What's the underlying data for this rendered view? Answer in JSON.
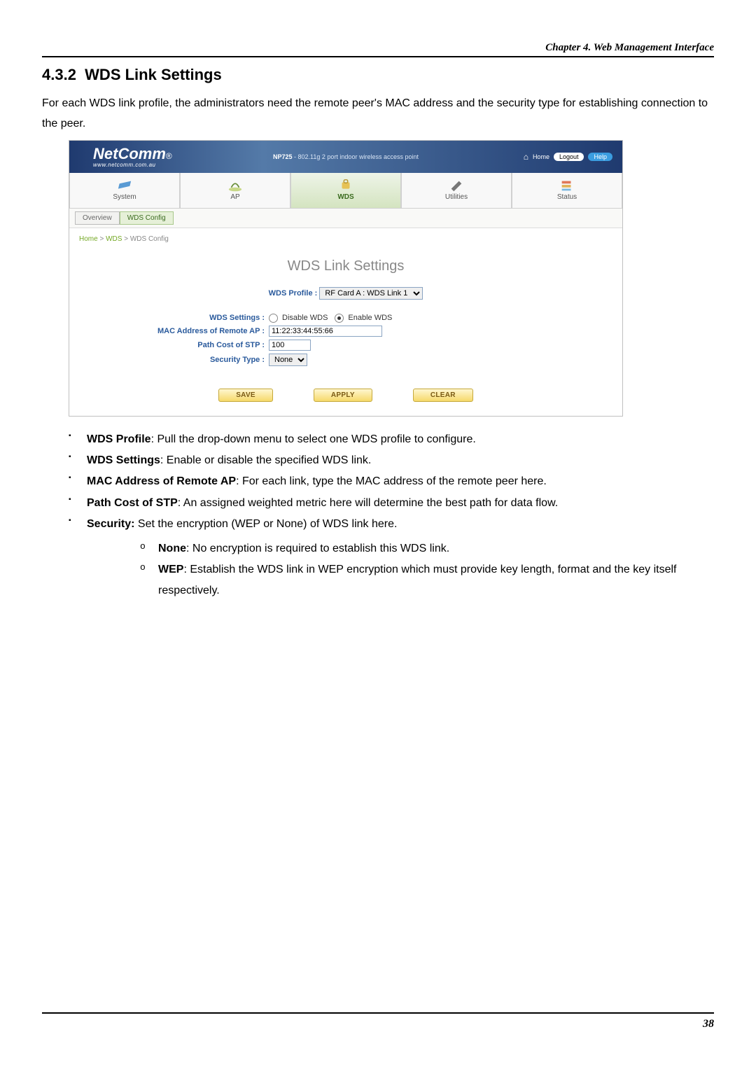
{
  "chapter_header": "Chapter 4. Web Management Interface",
  "section_number": "4.3.2",
  "section_title": "WDS Link Settings",
  "intro_text": "For each WDS link profile, the administrators need the remote peer's MAC address and the security type for establishing connection to the peer.",
  "screenshot": {
    "logo_text": "NetComm",
    "logo_sub": "www.netcomm.com.au",
    "product_name": "NP725",
    "product_desc": " - 802.11g 2 port indoor wireless access point",
    "top_home": "Home",
    "top_logout": "Logout",
    "top_help": "Help",
    "nav": [
      "System",
      "AP",
      "WDS",
      "Utilities",
      "Status"
    ],
    "subtabs": [
      "Overview",
      "WDS Config"
    ],
    "crumb_home": "Home",
    "crumb_wds": "WDS",
    "crumb_leaf": "WDS Config",
    "panel_title": "WDS Link Settings",
    "profile_label": "WDS Profile :",
    "profile_value": "RF Card A : WDS Link 1",
    "rows": {
      "wds_settings_label": "WDS Settings :",
      "disable_label": "Disable WDS",
      "enable_label": "Enable WDS",
      "mac_label": "MAC Address of Remote AP :",
      "mac_value": "11:22:33:44:55:66",
      "path_label": "Path Cost of STP :",
      "path_value": "100",
      "sec_label": "Security Type :",
      "sec_value": "None"
    },
    "buttons": {
      "save": "SAVE",
      "apply": "APPLY",
      "clear": "CLEAR"
    }
  },
  "bullets": {
    "b1_title": "WDS Profile",
    "b1_text": ": Pull the drop-down menu to select one WDS profile to configure.",
    "b2_title": "WDS Settings",
    "b2_text": ": Enable or disable the specified WDS link.",
    "b3_title": "MAC Address of Remote AP",
    "b3_text": ": For each link, type the MAC address of the remote peer here.",
    "b4_title": "Path Cost of STP",
    "b4_text": ": An assigned weighted metric here will determine the best path for data flow.",
    "b5_title": "Security:",
    "b5_text": " Set the encryption (WEP or None) of WDS link here.",
    "s1_title": "None",
    "s1_text": ": No encryption is required to establish this WDS link.",
    "s2_title": "WEP",
    "s2_text": ": Establish the WDS link in WEP encryption which must provide key length, format and the key itself respectively."
  },
  "page_number": "38"
}
